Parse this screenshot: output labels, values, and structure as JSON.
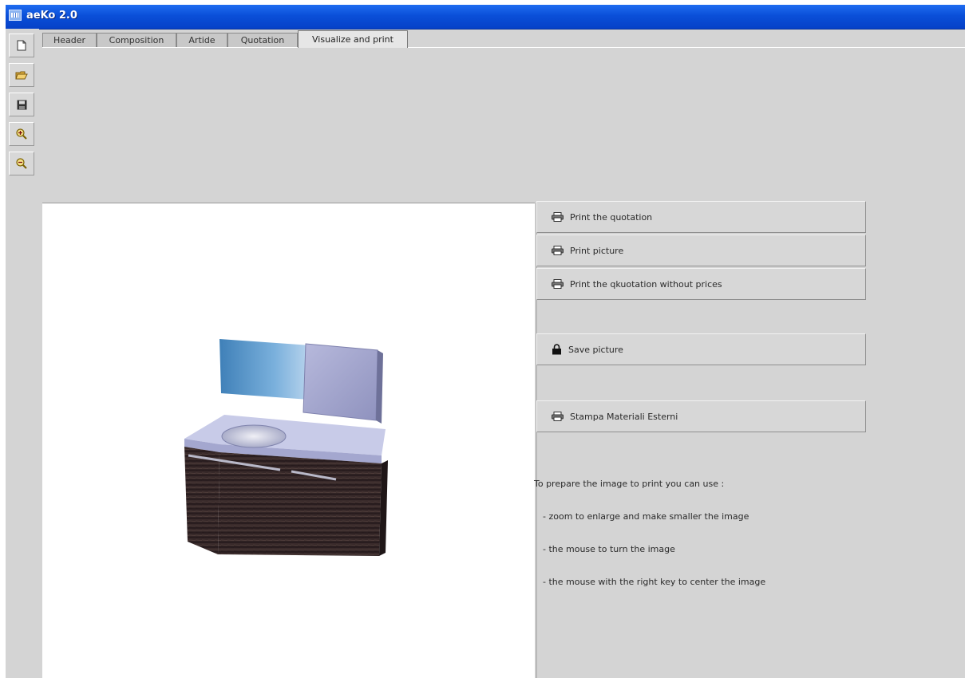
{
  "window": {
    "title": "aeKo 2.0"
  },
  "toolbar": {
    "buttons": [
      {
        "icon": "new-document-icon"
      },
      {
        "icon": "open-folder-icon"
      },
      {
        "icon": "save-disk-icon"
      },
      {
        "icon": "zoom-in-icon"
      },
      {
        "icon": "zoom-out-icon"
      }
    ]
  },
  "tabs": [
    {
      "label": "Header"
    },
    {
      "label": "Composition"
    },
    {
      "label": "Artide"
    },
    {
      "label": "Quotation"
    },
    {
      "label": "Visualize and print",
      "active": true
    }
  ],
  "actions": {
    "print_quotation": "Print the quotation",
    "print_picture": "Print picture",
    "print_no_prices": "Print the qkuotation without prices",
    "save_picture": "Save picture",
    "print_external": "Stampa Materiali Esterni"
  },
  "help": {
    "intro": "To prepare the image to print you can use :",
    "line1": "- zoom to enlarge and make smaller the image",
    "line2": "- the mouse to turn the image",
    "line3": "- the mouse with the right key to center the image"
  },
  "colors": {
    "titlebar": "#0a4fd8",
    "window_bg": "#d4d4d4",
    "viewport_bg": "#ffffff"
  }
}
